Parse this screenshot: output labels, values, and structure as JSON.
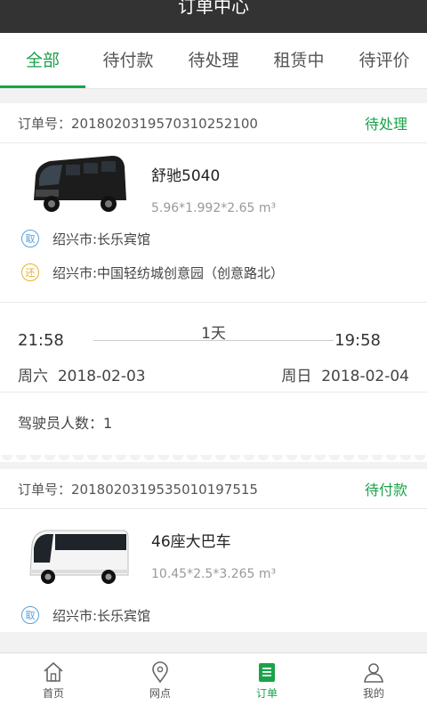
{
  "header": {
    "title": "订单中心"
  },
  "tabs": [
    {
      "label": "全部"
    },
    {
      "label": "待付款"
    },
    {
      "label": "待处理"
    },
    {
      "label": "租赁中"
    },
    {
      "label": "待评价"
    }
  ],
  "orders": [
    {
      "order_label": "订单号：",
      "order_no": "20180203195703102521​00",
      "status": "待处理",
      "vehicle_name": "舒驰5040",
      "vehicle_dim": "5.96*1.992*2.65 m³",
      "pickup_badge": "取",
      "pickup": "绍兴市:长乐宾馆",
      "return_badge": "还",
      "return": "绍兴市:中国轻纺城创意园（创意路北）",
      "start_time": "21:58",
      "end_time": "19:58",
      "duration": "1天",
      "start_day": "周六",
      "start_date": "2018-02-03",
      "end_day": "周日",
      "end_date": "2018-02-04",
      "drivers_label": "驾驶员人数：",
      "drivers": "1"
    },
    {
      "order_label": "订单号：",
      "order_no": "20180203195350101975​15",
      "status": "待付款",
      "vehicle_name": "46座大巴车",
      "vehicle_dim": "10.45*2.5*3.265 m³",
      "pickup_badge": "取",
      "pickup": "绍兴市:长乐宾馆"
    }
  ],
  "bottom_nav": [
    {
      "label": "首页",
      "icon": "home-icon"
    },
    {
      "label": "网点",
      "icon": "location-pin-icon"
    },
    {
      "label": "订单",
      "icon": "order-list-icon"
    },
    {
      "label": "我的",
      "icon": "user-icon"
    }
  ],
  "colors": {
    "accent": "#1aa34a",
    "header": "#333333",
    "pickup": "#5aa1d6",
    "return": "#e6b12f"
  }
}
